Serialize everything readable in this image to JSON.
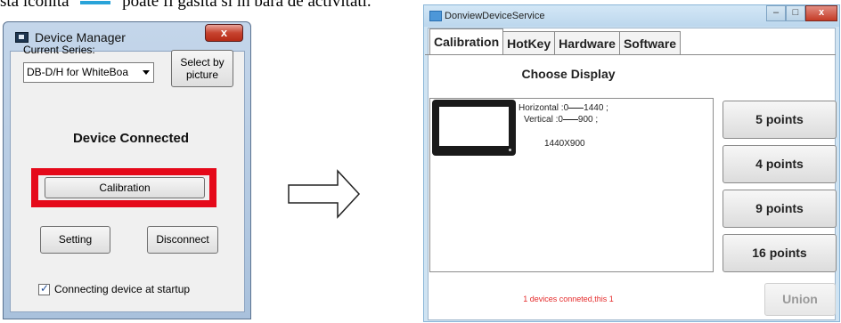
{
  "caption": {
    "before": "sta iconita",
    "after": "poate fi gasita si in bara de activitati."
  },
  "device_manager": {
    "title": "Device Manager",
    "close_label": "x",
    "series_label": "Current Series:",
    "series_value": "DB-D/H for WhiteBoa",
    "select_by_picture": "Select by picture",
    "status": "Device Connected",
    "calibration": "Calibration",
    "setting": "Setting",
    "disconnect": "Disconnect",
    "startup_label": "Connecting device at startup"
  },
  "donview": {
    "title": "DonviewDeviceService",
    "controls": {
      "minimize": "–",
      "maximize": "□",
      "close": "x"
    },
    "tabs": [
      "Calibration",
      "HotKey",
      "Hardware",
      "Software"
    ],
    "choose": "Choose Display",
    "horizontal": [
      "Horizontal :0",
      "1440 ;"
    ],
    "vertical": [
      "Vertical :0",
      "900 ;"
    ],
    "resolution": "1440X900",
    "points": [
      "5 points",
      "4 points",
      "9 points",
      "16 points"
    ],
    "status": "1 devices conneted,this 1",
    "union": "Union"
  },
  "colors": {
    "highlight": "#e5091a",
    "status_text": "#e52b2b",
    "icon_blue": "#29a3d9"
  }
}
